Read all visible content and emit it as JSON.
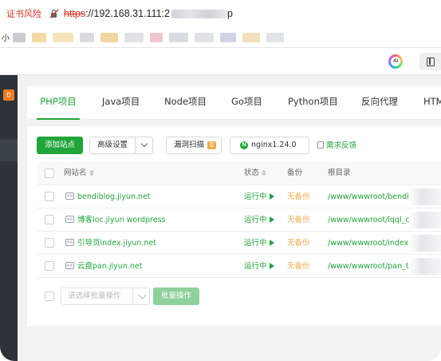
{
  "browser": {
    "cert_warning": "证书风险",
    "url_scheme": "https",
    "url_host": "://192.168.31.111:2",
    "url_tail": "p",
    "bookmark_first_label": "小",
    "toolbar": {
      "ai_icon": "AI"
    }
  },
  "sidebar": {
    "badge": "0"
  },
  "tabs": [
    {
      "label": "PHP项目",
      "active": true
    },
    {
      "label": "Java项目"
    },
    {
      "label": "Node项目"
    },
    {
      "label": "Go项目"
    },
    {
      "label": "Python项目"
    },
    {
      "label": "反向代理"
    },
    {
      "label": "HTM"
    }
  ],
  "actions": {
    "add_site": "添加站点",
    "advanced": "高级设置",
    "scan": "漏洞扫描",
    "scan_count": "0",
    "nginx_letter": "N",
    "nginx": "nginx1.24.0",
    "feedback": "需求反馈"
  },
  "table": {
    "columns": {
      "name": "网站名",
      "status": "状态",
      "backup": "备份",
      "root": "根目录"
    },
    "rows": [
      {
        "name": "bendiblog.jiyun.net",
        "status": "运行中",
        "backup": "无备份",
        "root": "/www/wwwroot/bendi"
      },
      {
        "name": "博客loc.jiyun wordpress",
        "status": "运行中",
        "backup": "无备份",
        "root": "/www/wwwroot/lqql_c"
      },
      {
        "name": "引导页index.jiyun.net",
        "status": "运行中",
        "backup": "无备份",
        "root": "/www/wwwroot/index"
      },
      {
        "name": "云盘pan.jiyun.net",
        "status": "运行中",
        "backup": "无备份",
        "root": "/www/wwwroot/pan_t"
      }
    ]
  },
  "bottom": {
    "batch_placeholder": "请选择批量操作",
    "batch_button": "批量操作"
  },
  "colors": {
    "accent": "#20a53a",
    "warning": "#f0ad4e",
    "danger": "#d93025",
    "sidebar": "#2d3338"
  }
}
